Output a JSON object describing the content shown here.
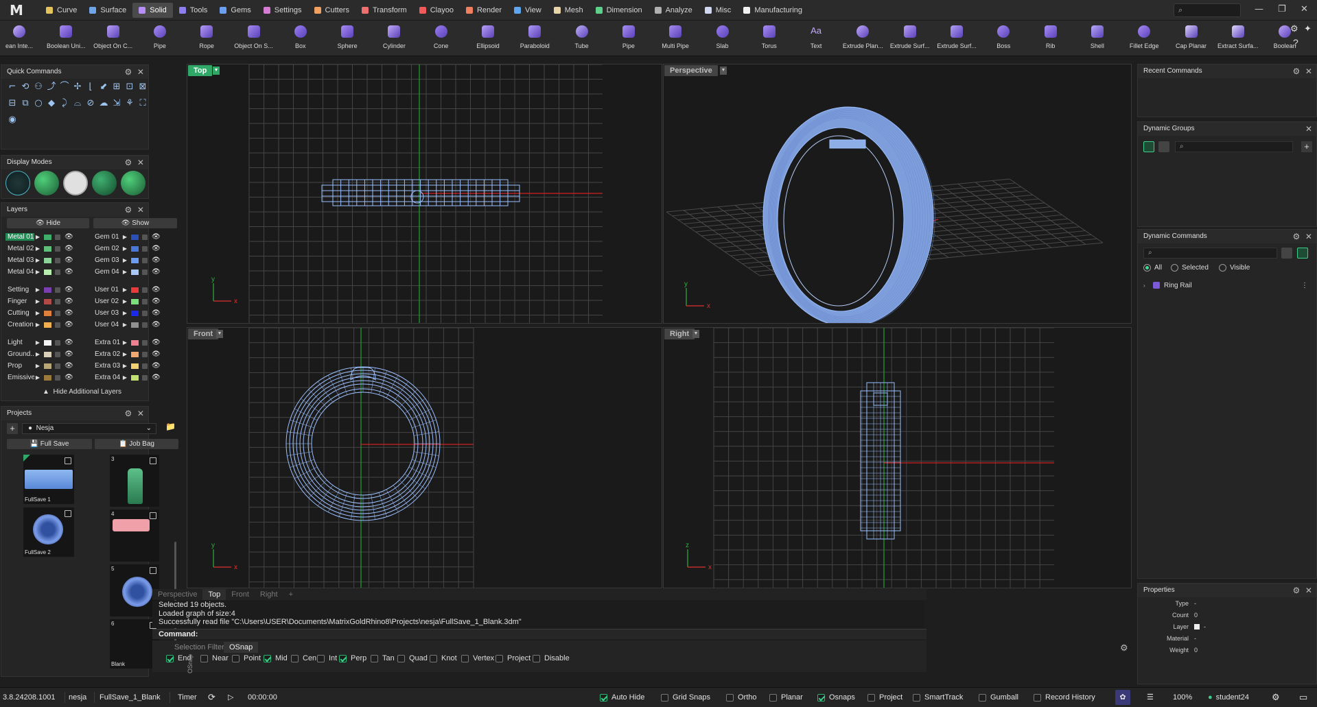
{
  "app": {
    "logo": "M"
  },
  "menu": [
    {
      "label": "Curve",
      "color": "#e2c35c"
    },
    {
      "label": "Surface",
      "color": "#6fa4e8"
    },
    {
      "label": "Solid",
      "color": "#b58ff5",
      "active": true
    },
    {
      "label": "Tools",
      "color": "#8d7ff0"
    },
    {
      "label": "Gems",
      "color": "#6b9ff2"
    },
    {
      "label": "Settings",
      "color": "#d77cd5"
    },
    {
      "label": "Cutters",
      "color": "#f0a060"
    },
    {
      "label": "Transform",
      "color": "#f07070"
    },
    {
      "label": "Clayoo",
      "color": "#f05a5a"
    },
    {
      "label": "Render",
      "color": "#f08060"
    },
    {
      "label": "View",
      "color": "#5fa6f0"
    },
    {
      "label": "Mesh",
      "color": "#e8d6a8"
    },
    {
      "label": "Dimension",
      "color": "#5ed08a"
    },
    {
      "label": "Analyze",
      "color": "#b0b0b0"
    },
    {
      "label": "Misc",
      "color": "#cfd8f0"
    },
    {
      "label": "Manufacturing",
      "color": "#f0f0f0"
    }
  ],
  "search": {
    "placeholder": "⌕"
  },
  "window": {
    "minimize": "—",
    "restore": "❐",
    "close": "✕"
  },
  "toolbar": [
    {
      "label": "ean Inte...",
      "icon": "intersect-icon"
    },
    {
      "label": "Boolean Uni...",
      "icon": "boolean-union-icon"
    },
    {
      "label": "Object On C...",
      "icon": "object-on-curve-icon"
    },
    {
      "label": "Pipe",
      "icon": "pipe-icon"
    },
    {
      "label": "Rope",
      "icon": "rope-icon"
    },
    {
      "label": "Object On S...",
      "icon": "object-on-surface-icon"
    },
    {
      "label": "Box",
      "icon": "box-icon"
    },
    {
      "label": "Sphere",
      "icon": "sphere-icon"
    },
    {
      "label": "Cylinder",
      "icon": "cylinder-icon"
    },
    {
      "label": "Cone",
      "icon": "cone-icon"
    },
    {
      "label": "Ellipsoid",
      "icon": "ellipsoid-icon"
    },
    {
      "label": "Paraboloid",
      "icon": "paraboloid-icon"
    },
    {
      "label": "Tube",
      "icon": "tube-icon"
    },
    {
      "label": "Pipe",
      "icon": "pipe-icon"
    },
    {
      "label": "Multi Pipe",
      "icon": "multi-pipe-icon"
    },
    {
      "label": "Slab",
      "icon": "slab-icon"
    },
    {
      "label": "Torus",
      "icon": "torus-icon"
    },
    {
      "label": "Text",
      "icon": "text-icon"
    },
    {
      "label": "Extrude Plan...",
      "icon": "extrude-planar-icon"
    },
    {
      "label": "Extrude Surf...",
      "icon": "extrude-surface-icon"
    },
    {
      "label": "Extrude Surf...",
      "icon": "extrude-surface-icon"
    },
    {
      "label": "Boss",
      "icon": "boss-icon"
    },
    {
      "label": "Rib",
      "icon": "rib-icon"
    },
    {
      "label": "Shell",
      "icon": "shell-icon"
    },
    {
      "label": "Fillet Edge",
      "icon": "fillet-edge-icon"
    },
    {
      "label": "Cap Planar",
      "icon": "cap-planar-icon"
    },
    {
      "label": "Extract Surfa...",
      "icon": "extract-surface-icon"
    },
    {
      "label": "Boolean",
      "icon": "boolean-icon"
    }
  ],
  "panels": {
    "quick_commands": "Quick Commands",
    "display_modes": "Display Modes",
    "layers": "Layers",
    "projects": "Projects",
    "recent_commands": "Recent Commands",
    "dynamic_groups": "Dynamic Groups",
    "dynamic_commands": "Dynamic Commands",
    "properties": "Properties"
  },
  "layers": {
    "hide": "Hide",
    "show": "Show",
    "footer": "Hide Additional Layers",
    "left": [
      {
        "name": "Metal 01",
        "color": "#3fae6a",
        "selected": true
      },
      {
        "name": "Metal 02",
        "color": "#5fc07a"
      },
      {
        "name": "Metal 03",
        "color": "#8ad49a"
      },
      {
        "name": "Metal 04",
        "color": "#b6efb0"
      },
      {
        "name": "Setting",
        "color": "#7a3fae"
      },
      {
        "name": "Finger",
        "color": "#b24a4a"
      },
      {
        "name": "Cutting",
        "color": "#e0803a"
      },
      {
        "name": "Creation",
        "color": "#f0b050"
      },
      {
        "name": "Light",
        "color": "#f4f4f4"
      },
      {
        "name": "Ground...",
        "color": "#d8d0b8"
      },
      {
        "name": "Prop",
        "color": "#b8a878"
      },
      {
        "name": "Emissive",
        "color": "#9a7a3a"
      }
    ],
    "right": [
      {
        "name": "Gem 01",
        "color": "#2a50b8"
      },
      {
        "name": "Gem 02",
        "color": "#4a78d8"
      },
      {
        "name": "Gem 03",
        "color": "#6c9cf0"
      },
      {
        "name": "Gem 04",
        "color": "#a8c8f8"
      },
      {
        "name": "User 01",
        "color": "#e83a3a"
      },
      {
        "name": "User 02",
        "color": "#7ae07a"
      },
      {
        "name": "User 03",
        "color": "#1a2ae8"
      },
      {
        "name": "User 04",
        "color": "#909090"
      },
      {
        "name": "Extra 01",
        "color": "#f08090"
      },
      {
        "name": "Extra 02",
        "color": "#f0a870"
      },
      {
        "name": "Extra 03",
        "color": "#f0d070"
      },
      {
        "name": "Extra 04",
        "color": "#c0e070"
      }
    ]
  },
  "projects": {
    "current": "Nesja",
    "full_save": "Full Save",
    "job_bag": "Job Bag",
    "left_thumbs": [
      "FullSave 1",
      "FullSave 2"
    ],
    "right_thumbs": [
      "3",
      "4",
      "5",
      "6",
      "Blank"
    ]
  },
  "viewports": {
    "top": "Top",
    "perspective": "Perspective",
    "front": "Front",
    "right": "Right"
  },
  "vp_tabs": [
    "Perspective",
    "Top",
    "Front",
    "Right",
    "+"
  ],
  "command": {
    "history": [
      "Selected 19 objects.",
      "Loaded graph of size:4",
      "Successfully read file \"C:\\Users\\USER\\Documents\\MatrixGoldRhino8\\Projects\\nesja\\FullSave_1_Blank.3dm\""
    ],
    "prompt": "Command:"
  },
  "osnap": {
    "tabs": [
      "Selection Filters",
      "OSnap"
    ],
    "side_label": "OSnap",
    "items": [
      {
        "label": "End",
        "checked": true
      },
      {
        "label": "Near",
        "checked": false
      },
      {
        "label": "Point",
        "checked": false
      },
      {
        "label": "Mid",
        "checked": true
      },
      {
        "label": "Cen",
        "checked": false
      },
      {
        "label": "Int",
        "checked": false
      },
      {
        "label": "Perp",
        "checked": true
      },
      {
        "label": "Tan",
        "checked": false
      },
      {
        "label": "Quad",
        "checked": false
      },
      {
        "label": "Knot",
        "checked": false
      },
      {
        "label": "Vertex",
        "checked": false
      },
      {
        "label": "Project",
        "checked": false
      },
      {
        "label": "Disable",
        "checked": false
      }
    ]
  },
  "dynamic_commands": {
    "filters": [
      {
        "label": "All",
        "on": true
      },
      {
        "label": "Selected",
        "on": false
      },
      {
        "label": "Visible",
        "on": false
      }
    ],
    "items": [
      "Ring Rail"
    ]
  },
  "properties": {
    "rows": [
      {
        "key": "Type",
        "value": "-"
      },
      {
        "key": "Count",
        "value": "0"
      },
      {
        "key": "Layer",
        "value": "-"
      },
      {
        "key": "Material",
        "value": "-"
      },
      {
        "key": "Weight",
        "value": "0"
      }
    ]
  },
  "status": {
    "version": "3.8.24208.1001",
    "project": "nesja",
    "file": "FullSave_1_Blank",
    "timer_label": "Timer",
    "time": "00:00:00",
    "toggles": [
      {
        "label": "Auto Hide",
        "checked": true
      },
      {
        "label": "Grid Snaps",
        "checked": false
      },
      {
        "label": "Ortho",
        "checked": false
      },
      {
        "label": "Planar",
        "checked": false
      },
      {
        "label": "Osnaps",
        "checked": true
      },
      {
        "label": "Project",
        "checked": false
      },
      {
        "label": "SmartTrack",
        "checked": false
      },
      {
        "label": "Gumball",
        "checked": false
      },
      {
        "label": "Record History",
        "checked": false
      }
    ],
    "zoom": "100%",
    "user": "student24"
  }
}
